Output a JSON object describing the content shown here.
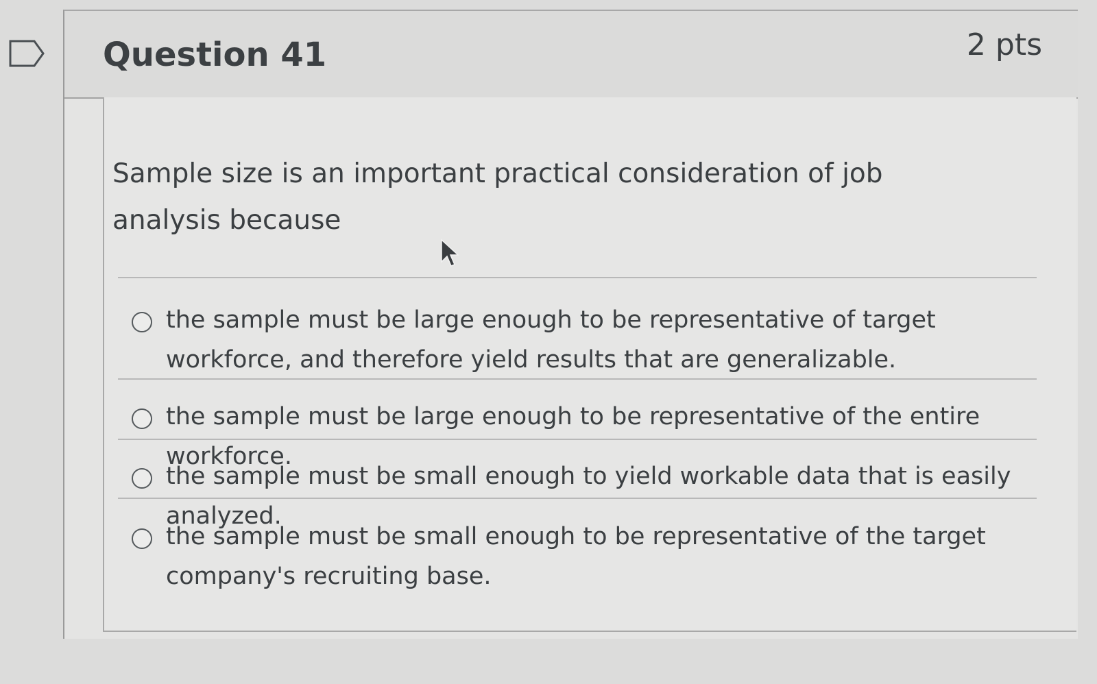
{
  "question": {
    "title": "Question 41",
    "points": "2 pts",
    "text": "Sample size is an important practical consideration of job analysis because"
  },
  "answers": [
    {
      "label": "the sample must be large enough to be representative of target workforce, and therefore yield results that are generalizable.",
      "selected": false
    },
    {
      "label": "the sample must be large enough to be representative of the entire workforce.",
      "selected": false
    },
    {
      "label": "the sample must be small enough to yield workable data that is easily analyzed.",
      "selected": false
    },
    {
      "label": "the sample must be small enough to be representative of the target company's recruiting base.",
      "selected": false
    }
  ],
  "icons": {
    "flag": "bookmark-flag-icon",
    "cursor": "mouse-pointer-icon",
    "radio": "radio-unchecked-icon"
  },
  "colors": {
    "text": "#3b3f42",
    "background": "#e4e4e3",
    "border": "#a3a3a3"
  }
}
